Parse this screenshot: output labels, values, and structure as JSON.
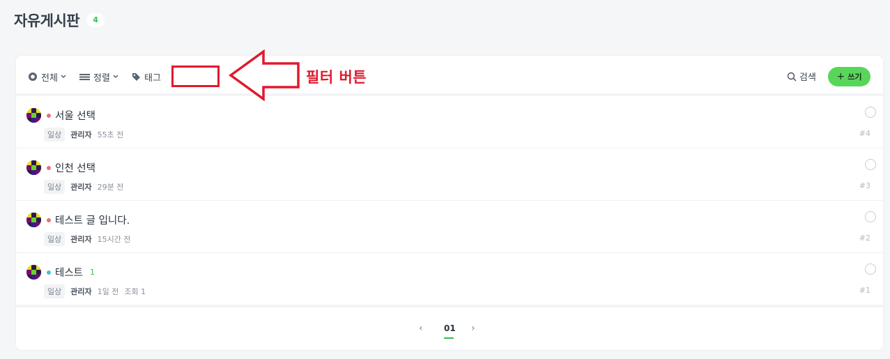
{
  "header": {
    "title": "자유게시판",
    "count": "4"
  },
  "toolbar": {
    "all_label": "전체",
    "sort_label": "정렬",
    "tag_label": "태그",
    "search_label": "검색",
    "write_label": "쓰기",
    "write_plus": "+"
  },
  "annotation": {
    "text": "필터 버튼",
    "color": "#e0192d"
  },
  "posts": [
    {
      "title": "서울 선택",
      "dot_color": "#e8707a",
      "comments": "",
      "category": "일상",
      "author": "관리자",
      "time": "55초 전",
      "views": "",
      "number": "#4"
    },
    {
      "title": "인천 선택",
      "dot_color": "#e8707a",
      "comments": "",
      "category": "일상",
      "author": "관리자",
      "time": "29분 전",
      "views": "",
      "number": "#3"
    },
    {
      "title": "테스트 글 입니다.",
      "dot_color": "#e8707a",
      "comments": "",
      "category": "일상",
      "author": "관리자",
      "time": "15시간 전",
      "views": "",
      "number": "#2"
    },
    {
      "title": "테스트",
      "dot_color": "#4fb8d8",
      "comments": "1",
      "category": "일상",
      "author": "관리자",
      "time": "1일 전",
      "views": "조회 1",
      "number": "#1"
    }
  ],
  "pagination": {
    "prev": "‹",
    "current": "01",
    "next": "›"
  },
  "colors": {
    "accent": "#58d65a",
    "comment": "#33c14a"
  }
}
